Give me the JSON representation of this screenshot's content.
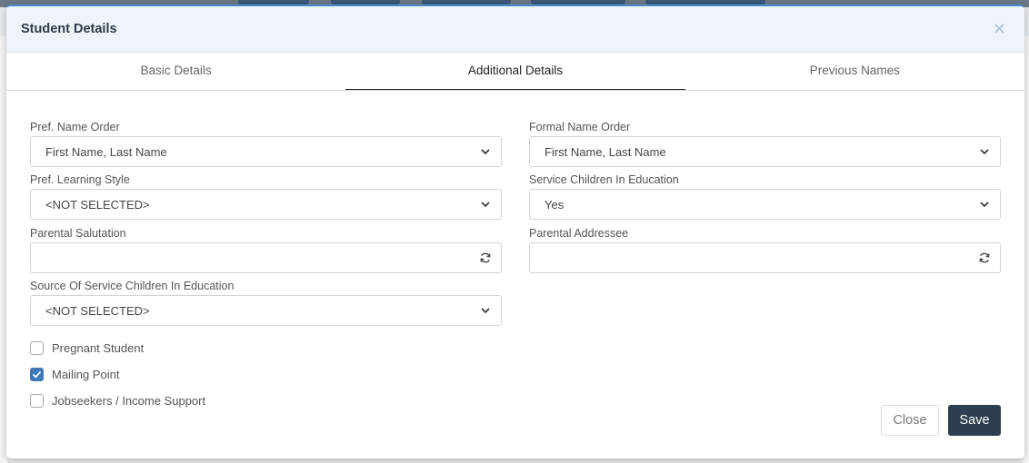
{
  "modal": {
    "title": "Student Details",
    "close_icon": "close-icon"
  },
  "tabs": [
    {
      "label": "Basic Details",
      "active": false
    },
    {
      "label": "Additional Details",
      "active": true
    },
    {
      "label": "Previous Names",
      "active": false
    }
  ],
  "fields": {
    "pref_name_order": {
      "label": "Pref. Name Order",
      "value": "First Name, Last Name"
    },
    "formal_name_order": {
      "label": "Formal Name Order",
      "value": "First Name, Last Name"
    },
    "pref_learning_style": {
      "label": "Pref. Learning Style",
      "value": "<NOT SELECTED>"
    },
    "service_children": {
      "label": "Service Children In Education",
      "value": "Yes"
    },
    "parental_salutation": {
      "label": "Parental Salutation",
      "value": ""
    },
    "parental_addressee": {
      "label": "Parental Addressee",
      "value": ""
    },
    "source_service_children": {
      "label": "Source Of Service Children In Education",
      "value": "<NOT SELECTED>"
    }
  },
  "checkboxes": [
    {
      "label": "Pregnant Student",
      "checked": false
    },
    {
      "label": "Mailing Point",
      "checked": true
    },
    {
      "label": "Jobseekers / Income Support",
      "checked": false
    }
  ],
  "buttons": {
    "close_label": "Close",
    "save_label": "Save"
  },
  "colors": {
    "accent": "#3d79b8",
    "save_bg": "#2c3e50",
    "header_bg": "#eef4fa"
  }
}
